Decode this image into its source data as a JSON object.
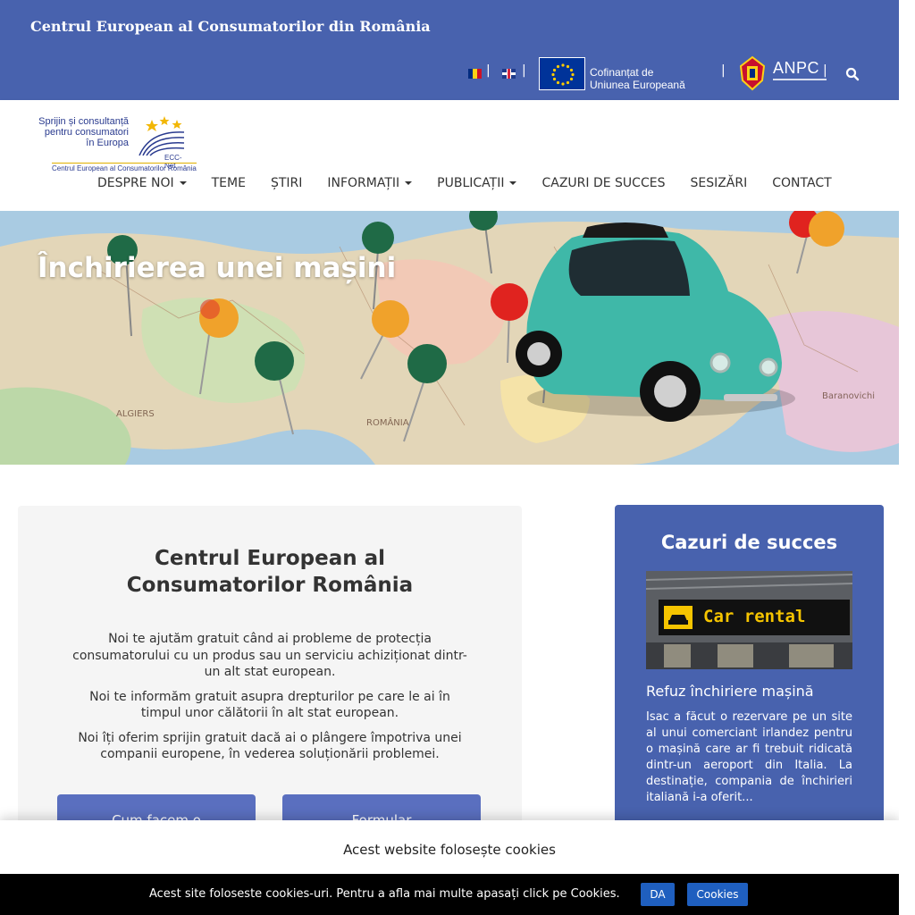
{
  "site": {
    "title": "Centrul European al Consumatorilor din România"
  },
  "utility": {
    "lang_ro": "RO",
    "lang_en": "EN",
    "eu_line1": "Cofinanțat de",
    "eu_line2": "Uniunea Europeană",
    "anpc": "ANPC",
    "separator": "|"
  },
  "logo": {
    "line1": "Sprijin și consultanță",
    "line2": "pentru consumatori",
    "line3": "în Europa",
    "network": "ECC-Net",
    "caption": "Centrul European al Consumatorilor România"
  },
  "nav": {
    "items": [
      {
        "label": "DESPRE NOI",
        "dropdown": true
      },
      {
        "label": "TEME",
        "dropdown": false
      },
      {
        "label": "ȘTIRI",
        "dropdown": false
      },
      {
        "label": "INFORMAȚII",
        "dropdown": true
      },
      {
        "label": "PUBLICAȚII",
        "dropdown": true
      },
      {
        "label": "CAZURI DE SUCCES",
        "dropdown": false
      },
      {
        "label": "SESIZĂRI",
        "dropdown": false
      },
      {
        "label": "CONTACT",
        "dropdown": false
      }
    ]
  },
  "hero": {
    "title": "Închirierea unei mașini"
  },
  "info": {
    "title_line1": "Centrul European al",
    "title_line2": "Consumatorilor România",
    "para1": "Noi te ajutăm gratuit când ai probleme de protecția consumatorului cu un produs sau un serviciu achiziționat dintr-un alt stat european.",
    "para2": "Noi te informăm gratuit asupra drepturilor pe care le ai în timpul unor călătorii în alt stat european.",
    "para3": "Noi îți oferim sprijin gratuit dacă ai o plângere împotriva unei companii europene, în vederea soluționării problemei.",
    "button1": "Cum facem o",
    "button2": "Formular"
  },
  "success": {
    "title": "Cazuri de succes",
    "image_sign": "Car rental",
    "case_title": "Refuz închiriere mașină",
    "excerpt": "Isac a făcut o rezervare pe un site al unui comerciant irlandez pentru o mașină care ar fi trebuit ridicată dintr-un aeroport din Italia. La destinație, compania de închirieri italiană i-a oferit..."
  },
  "cookies": {
    "panel_text": "Acest website folosește cookies",
    "bar_text": "Acest site foloseste cookies-uri. Pentru a afla mai multe apasați click pe Cookies.",
    "accept": "DA",
    "more": "Cookies"
  },
  "colors": {
    "brand_blue": "#4862ae",
    "button_blue": "#5a6fbf",
    "cookie_button": "#1f5fbf",
    "eu_blue": "#003399",
    "eu_gold": "#ffcc00",
    "car_teal": "#3fb8a8"
  },
  "icons": {
    "search": "search-icon",
    "eu_flag": "eu-flag-icon",
    "anpc_crest": "anpc-crest-icon"
  }
}
